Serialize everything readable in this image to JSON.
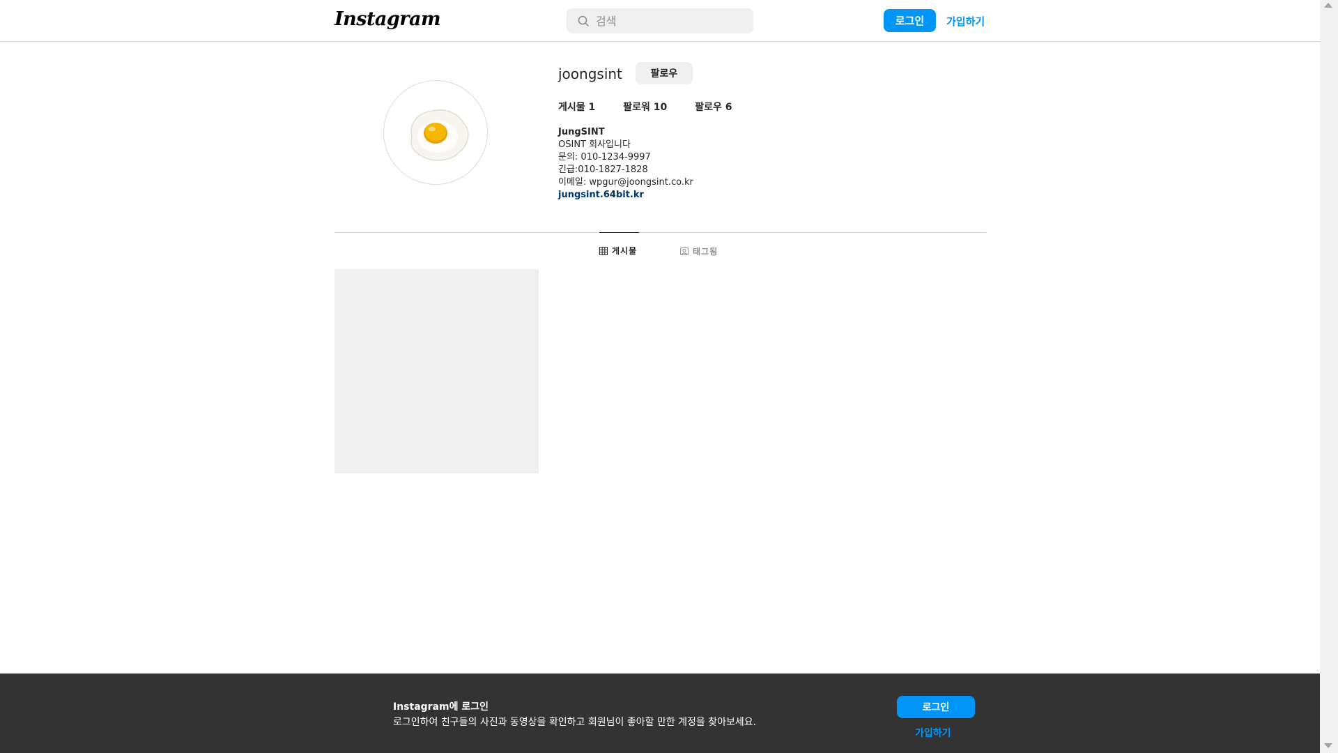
{
  "header": {
    "logo": "Instagram",
    "search_placeholder": "검색",
    "login_label": "로그인",
    "signup_label": "가입하기"
  },
  "profile": {
    "username": "joongsint",
    "follow_label": "팔로우",
    "stats": {
      "posts": "게시물 1",
      "followers": "팔로워 10",
      "following": "팔로우 6"
    },
    "bio": {
      "name": "JungSINT",
      "line1": "OSINT 회사입니다",
      "line2": "문의: 010-1234-9997",
      "line3": "긴급:010-1827-1828",
      "line4": "이메일: wpgur@joongsint.co.kr",
      "link": "jungsint.64bit.kr"
    }
  },
  "tabs": [
    {
      "label": "게시물",
      "active": true,
      "icon": "grid-icon"
    },
    {
      "label": "태그됨",
      "active": false,
      "icon": "tag-icon"
    }
  ],
  "banner": {
    "title": "Instagram에 로그인",
    "subtitle": "로그인하여 친구들의 사진과 동영상을 확인하고 회원님이 좋아할 만한 계정을 찾아보세요.",
    "login_label": "로그인",
    "signup_label": "가입하기"
  },
  "colors": {
    "accent": "#0095f6",
    "banner_bg": "#333333",
    "link": "#00376b"
  }
}
